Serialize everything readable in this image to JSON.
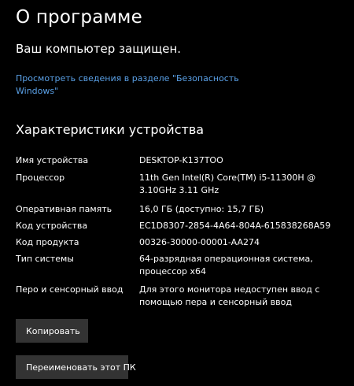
{
  "page": {
    "title": "О программе",
    "protection_status": "Ваш компьютер защищен.",
    "security_link": "Просмотреть сведения в разделе \"Безопасность Windows\""
  },
  "device_specs": {
    "section_title": "Характеристики устройства",
    "rows": [
      {
        "label": "Имя устройства",
        "value": "DESKTOP-K137TOO"
      },
      {
        "label": "Процессор",
        "value": "11th Gen Intel(R) Core(TM) i5-11300H @ 3.10GHz   3.11 GHz"
      },
      {
        "label": "Оперативная память",
        "value": "16,0 ГБ (доступно: 15,7 ГБ)"
      },
      {
        "label": "Код устройства",
        "value": "EC1D8307-2854-4A64-804A-615838268A59"
      },
      {
        "label": "Код продукта",
        "value": "00326-30000-00001-AA274"
      },
      {
        "label": "Тип системы",
        "value": "64-разрядная операционная система, процессор x64"
      },
      {
        "label": "Перо и сенсорный ввод",
        "value": "Для этого монитора недоступен ввод с помощью пера и сенсорный ввод"
      }
    ]
  },
  "buttons": {
    "copy_label": "Копировать",
    "rename_label": "Переименовать этот ПК"
  },
  "colors": {
    "background": "#000000",
    "text": "#ffffff",
    "link": "#5aa0e6",
    "button_bg": "#333333"
  }
}
